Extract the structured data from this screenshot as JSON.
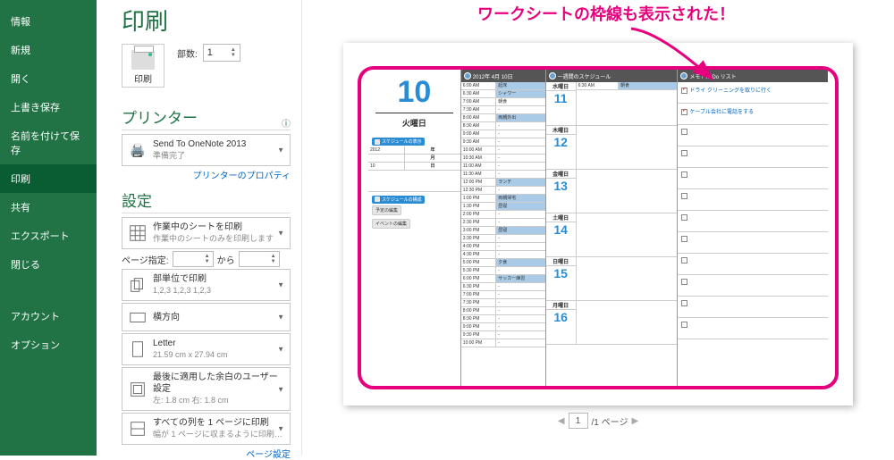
{
  "sidebar": {
    "items": [
      {
        "label": "情報",
        "active": false
      },
      {
        "label": "新規",
        "active": false
      },
      {
        "label": "開く",
        "active": false
      },
      {
        "label": "上書き保存",
        "active": false
      },
      {
        "label": "名前を付けて保存",
        "active": false
      },
      {
        "label": "印刷",
        "active": true
      },
      {
        "label": "共有",
        "active": false
      },
      {
        "label": "エクスポート",
        "active": false
      },
      {
        "label": "閉じる",
        "active": false
      }
    ],
    "footer": [
      {
        "label": "アカウント"
      },
      {
        "label": "オプション"
      }
    ]
  },
  "print": {
    "title": "印刷",
    "copies_label": "部数:",
    "copies_value": "1",
    "button_label": "印刷"
  },
  "printer": {
    "section_title": "プリンター",
    "name": "Send To OneNote 2013",
    "status": "準備完了",
    "properties_link": "プリンターのプロパティ"
  },
  "settings": {
    "section_title": "設定",
    "sheet": {
      "t1": "作業中のシートを印刷",
      "t2": "作業中のシートのみを印刷します"
    },
    "page_range": {
      "label": "ページ指定:",
      "sep": "から"
    },
    "collate": {
      "t1": "部単位で印刷",
      "t2": "1,2,3   1,2,3   1,2,3"
    },
    "orientation": {
      "t1": "横方向"
    },
    "paper": {
      "t1": "Letter",
      "t2": "21.59 cm x 27.94 cm"
    },
    "margins": {
      "t1": "最後に適用した余白のユーザー設定",
      "t2": "左: 1.8 cm   右: 1.8 cm"
    },
    "scaling": {
      "t1": "すべての列を 1 ページに印刷",
      "t2": "幅が 1 ページに収まるように印刷…"
    },
    "page_setup_link": "ページ設定"
  },
  "annotation": "ワークシートの枠線も表示された！",
  "page_nav": {
    "current": "1",
    "total_label": "/1 ページ"
  },
  "doc": {
    "date_header": "2012年 4月 10日",
    "big_day": "10",
    "dow": "火曜日",
    "sec1": "スケジュールの表示",
    "sec2": "スケジュールの構成",
    "yr_row": {
      "v": "2012",
      "l": "年"
    },
    "mo_row": {
      "v": "",
      "l": "月"
    },
    "dy_row": {
      "v": "10",
      "l": "日"
    },
    "btn1": "予定の編集",
    "btn2": "イベントの編集",
    "week_title": "一週間のスケジュール",
    "memo_title": "メモ / To Do リスト",
    "days": [
      {
        "lbl": "水曜日",
        "num": "11"
      },
      {
        "lbl": "木曜日",
        "num": "12"
      },
      {
        "lbl": "金曜日",
        "num": "13"
      },
      {
        "lbl": "土曜日",
        "num": "14"
      },
      {
        "lbl": "日曜日",
        "num": "15"
      },
      {
        "lbl": "月曜日",
        "num": "16"
      }
    ],
    "week_event_time": "6:30 AM",
    "week_event_text": "朝食",
    "timeline": [
      {
        "t": "6:00 AM",
        "v": "起床",
        "bar": true
      },
      {
        "t": "6:30 AM",
        "v": "シャワー",
        "bar": true
      },
      {
        "t": "7:00 AM",
        "v": "朝食",
        "bar": false
      },
      {
        "t": "7:30 AM",
        "v": "-",
        "bar": false
      },
      {
        "t": "8:00 AM",
        "v": "両親外出",
        "bar": true
      },
      {
        "t": "8:30 AM",
        "v": "-",
        "bar": false
      },
      {
        "t": "9:00 AM",
        "v": "-",
        "bar": false
      },
      {
        "t": "9:30 AM",
        "v": "-",
        "bar": false
      },
      {
        "t": "10:00 AM",
        "v": "-",
        "bar": false
      },
      {
        "t": "10:30 AM",
        "v": "-",
        "bar": false
      },
      {
        "t": "11:00 AM",
        "v": "-",
        "bar": false
      },
      {
        "t": "11:30 AM",
        "v": "-",
        "bar": false
      },
      {
        "t": "12:00 PM",
        "v": "ランチ",
        "bar": true
      },
      {
        "t": "12:30 PM",
        "v": "-",
        "bar": false
      },
      {
        "t": "1:00 PM",
        "v": "両親帰宅",
        "bar": true
      },
      {
        "t": "1:30 PM",
        "v": "昼寝",
        "bar": true
      },
      {
        "t": "2:00 PM",
        "v": "-",
        "bar": false
      },
      {
        "t": "2:30 PM",
        "v": "-",
        "bar": false
      },
      {
        "t": "3:00 PM",
        "v": "昼寝",
        "bar": true
      },
      {
        "t": "3:30 PM",
        "v": "-",
        "bar": false
      },
      {
        "t": "4:00 PM",
        "v": "-",
        "bar": false
      },
      {
        "t": "4:30 PM",
        "v": "-",
        "bar": false
      },
      {
        "t": "5:00 PM",
        "v": "夕食",
        "bar": true
      },
      {
        "t": "5:30 PM",
        "v": "-",
        "bar": false
      },
      {
        "t": "6:00 PM",
        "v": "サッカー練習",
        "bar": true
      },
      {
        "t": "6:30 PM",
        "v": "-",
        "bar": false
      },
      {
        "t": "7:00 PM",
        "v": "-",
        "bar": false
      },
      {
        "t": "7:30 PM",
        "v": "-",
        "bar": false
      },
      {
        "t": "8:00 PM",
        "v": "-",
        "bar": false
      },
      {
        "t": "8:30 PM",
        "v": "-",
        "bar": false
      },
      {
        "t": "9:00 PM",
        "v": "-",
        "bar": false
      },
      {
        "t": "9:30 PM",
        "v": "-",
        "bar": false
      },
      {
        "t": "10:00 PM",
        "v": "-",
        "bar": false
      }
    ],
    "todos": [
      {
        "checked": true,
        "text": "ドライ クリーニングを取りに行く"
      },
      {
        "checked": true,
        "text": "ケーブル会社に電話をする"
      }
    ]
  }
}
